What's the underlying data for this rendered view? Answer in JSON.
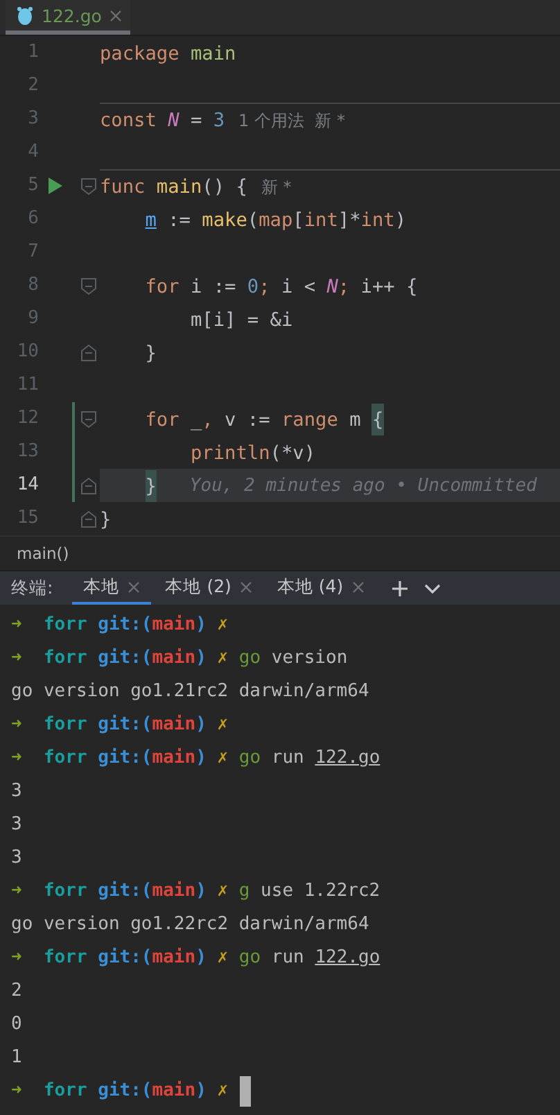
{
  "editor": {
    "tabs": [
      {
        "label": "122.go",
        "selected": true
      }
    ],
    "lines": [
      {
        "number": "1",
        "tokens": [
          {
            "kind": "keyword",
            "text": "package "
          },
          {
            "kind": "package",
            "text": "main"
          }
        ]
      },
      {
        "number": "2"
      },
      {
        "number": "3",
        "separator_above": true,
        "tokens": [
          {
            "kind": "keyword",
            "text": "const "
          },
          {
            "kind": "constant",
            "text": "N"
          },
          {
            "kind": "plain",
            "text": " = "
          },
          {
            "kind": "number",
            "text": "3"
          }
        ],
        "hint": "1 个用法  新 *"
      },
      {
        "number": "4"
      },
      {
        "number": "5",
        "separator_above": true,
        "run": true,
        "fold_start": true,
        "tokens": [
          {
            "kind": "keyword",
            "text": "func "
          },
          {
            "kind": "function",
            "text": "main"
          },
          {
            "kind": "plain",
            "text": "() {"
          }
        ],
        "hint": "新 *"
      },
      {
        "number": "6",
        "tokens": [
          {
            "kind": "indent"
          },
          {
            "kind": "variable",
            "text": "m"
          },
          {
            "kind": "plain",
            "text": " := "
          },
          {
            "kind": "function",
            "text": "make"
          },
          {
            "kind": "plain",
            "text": "("
          },
          {
            "kind": "keyword",
            "text": "map"
          },
          {
            "kind": "plain",
            "text": "["
          },
          {
            "kind": "keyword",
            "text": "int"
          },
          {
            "kind": "plain",
            "text": "]*"
          },
          {
            "kind": "keyword",
            "text": "int"
          },
          {
            "kind": "plain",
            "text": ")"
          }
        ]
      },
      {
        "number": "7"
      },
      {
        "number": "8",
        "fold_start": true,
        "tokens": [
          {
            "kind": "indent"
          },
          {
            "kind": "keyword",
            "text": "for"
          },
          {
            "kind": "plain",
            "text": " i := "
          },
          {
            "kind": "number",
            "text": "0"
          },
          {
            "kind": "keyword",
            "text": ";"
          },
          {
            "kind": "plain",
            "text": " i < "
          },
          {
            "kind": "constant",
            "text": "N"
          },
          {
            "kind": "keyword",
            "text": ";"
          },
          {
            "kind": "plain",
            "text": " i++ {"
          }
        ]
      },
      {
        "number": "9",
        "tokens": [
          {
            "kind": "indent"
          },
          {
            "kind": "indent"
          },
          {
            "kind": "plain",
            "text": "m[i] = &i"
          }
        ]
      },
      {
        "number": "10",
        "fold_end": true,
        "tokens": [
          {
            "kind": "indent"
          },
          {
            "kind": "plain",
            "text": "}"
          }
        ]
      },
      {
        "number": "11"
      },
      {
        "number": "12",
        "fold_start": true,
        "changed": true,
        "tokens": [
          {
            "kind": "indent"
          },
          {
            "kind": "keyword",
            "text": "for"
          },
          {
            "kind": "plain",
            "text": " _"
          },
          {
            "kind": "keyword",
            "text": ","
          },
          {
            "kind": "plain",
            "text": " v := "
          },
          {
            "kind": "keyword",
            "text": "range"
          },
          {
            "kind": "plain",
            "text": " m "
          },
          {
            "kind": "brace-match",
            "text": "{"
          }
        ]
      },
      {
        "number": "13",
        "changed": true,
        "tokens": [
          {
            "kind": "indent"
          },
          {
            "kind": "indent"
          },
          {
            "kind": "keyword",
            "text": "println"
          },
          {
            "kind": "plain",
            "text": "(*v)"
          }
        ]
      },
      {
        "number": "14",
        "fold_end": true,
        "changed": true,
        "current": true,
        "tokens": [
          {
            "kind": "indent"
          },
          {
            "kind": "brace-match",
            "text": "}"
          }
        ],
        "blame": "You, 2 minutes ago • Uncommitted"
      },
      {
        "number": "15",
        "fold_end": true,
        "tokens": [
          {
            "kind": "plain",
            "text": "}"
          }
        ]
      }
    ]
  },
  "breadcrumb": "main()",
  "terminal": {
    "label": "终端:",
    "tabs": [
      {
        "label": "本地",
        "selected": true
      },
      {
        "label": "本地 (2)",
        "selected": false
      },
      {
        "label": "本地 (4)",
        "selected": false
      }
    ],
    "lines": [
      {
        "tokens": [
          {
            "kind": "arrow",
            "text": "➜"
          },
          {
            "kind": "dir",
            "text": "  forr"
          },
          {
            "kind": "git",
            "text": " git:("
          },
          {
            "kind": "branch",
            "text": "main"
          },
          {
            "kind": "git",
            "text": ")"
          },
          {
            "kind": "dirty",
            "text": " ✗"
          }
        ]
      },
      {
        "tokens": [
          {
            "kind": "arrow",
            "text": "➜"
          },
          {
            "kind": "dir",
            "text": "  forr"
          },
          {
            "kind": "git",
            "text": " git:("
          },
          {
            "kind": "branch",
            "text": "main"
          },
          {
            "kind": "git",
            "text": ")"
          },
          {
            "kind": "dirty",
            "text": " ✗"
          },
          {
            "kind": "command",
            "text": " go"
          },
          {
            "kind": "plain",
            "text": " version"
          }
        ]
      },
      {
        "tokens": [
          {
            "kind": "plain",
            "text": "go version go1.21rc2 darwin/arm64"
          }
        ]
      },
      {
        "tokens": [
          {
            "kind": "arrow",
            "text": "➜"
          },
          {
            "kind": "dir",
            "text": "  forr"
          },
          {
            "kind": "git",
            "text": " git:("
          },
          {
            "kind": "branch",
            "text": "main"
          },
          {
            "kind": "git",
            "text": ")"
          },
          {
            "kind": "dirty",
            "text": " ✗"
          }
        ]
      },
      {
        "tokens": [
          {
            "kind": "arrow",
            "text": "➜"
          },
          {
            "kind": "dir",
            "text": "  forr"
          },
          {
            "kind": "git",
            "text": " git:("
          },
          {
            "kind": "branch",
            "text": "main"
          },
          {
            "kind": "git",
            "text": ")"
          },
          {
            "kind": "dirty",
            "text": " ✗"
          },
          {
            "kind": "command",
            "text": " go"
          },
          {
            "kind": "plain",
            "text": " run "
          },
          {
            "kind": "link",
            "text": "122.go"
          }
        ]
      },
      {
        "tokens": [
          {
            "kind": "plain",
            "text": "3"
          }
        ]
      },
      {
        "tokens": [
          {
            "kind": "plain",
            "text": "3"
          }
        ]
      },
      {
        "tokens": [
          {
            "kind": "plain",
            "text": "3"
          }
        ]
      },
      {
        "tokens": [
          {
            "kind": "arrow",
            "text": "➜"
          },
          {
            "kind": "dir",
            "text": "  forr"
          },
          {
            "kind": "git",
            "text": " git:("
          },
          {
            "kind": "branch",
            "text": "main"
          },
          {
            "kind": "git",
            "text": ")"
          },
          {
            "kind": "dirty",
            "text": " ✗"
          },
          {
            "kind": "command",
            "text": " g"
          },
          {
            "kind": "plain",
            "text": " use 1.22rc2"
          }
        ]
      },
      {
        "tokens": [
          {
            "kind": "plain",
            "text": "go version go1.22rc2 darwin/arm64"
          }
        ]
      },
      {
        "tokens": [
          {
            "kind": "arrow",
            "text": "➜"
          },
          {
            "kind": "dir",
            "text": "  forr"
          },
          {
            "kind": "git",
            "text": " git:("
          },
          {
            "kind": "branch",
            "text": "main"
          },
          {
            "kind": "git",
            "text": ")"
          },
          {
            "kind": "dirty",
            "text": " ✗"
          },
          {
            "kind": "command",
            "text": " go"
          },
          {
            "kind": "plain",
            "text": " run "
          },
          {
            "kind": "link",
            "text": "122.go"
          }
        ]
      },
      {
        "tokens": [
          {
            "kind": "plain",
            "text": "2"
          }
        ]
      },
      {
        "tokens": [
          {
            "kind": "plain",
            "text": "0"
          }
        ]
      },
      {
        "tokens": [
          {
            "kind": "plain",
            "text": "1"
          }
        ]
      },
      {
        "cursor": true,
        "tokens": [
          {
            "kind": "arrow",
            "text": "➜"
          },
          {
            "kind": "dir",
            "text": "  forr"
          },
          {
            "kind": "git",
            "text": " git:("
          },
          {
            "kind": "branch",
            "text": "main"
          },
          {
            "kind": "git",
            "text": ")"
          },
          {
            "kind": "dirty",
            "text": " ✗"
          }
        ]
      }
    ]
  }
}
